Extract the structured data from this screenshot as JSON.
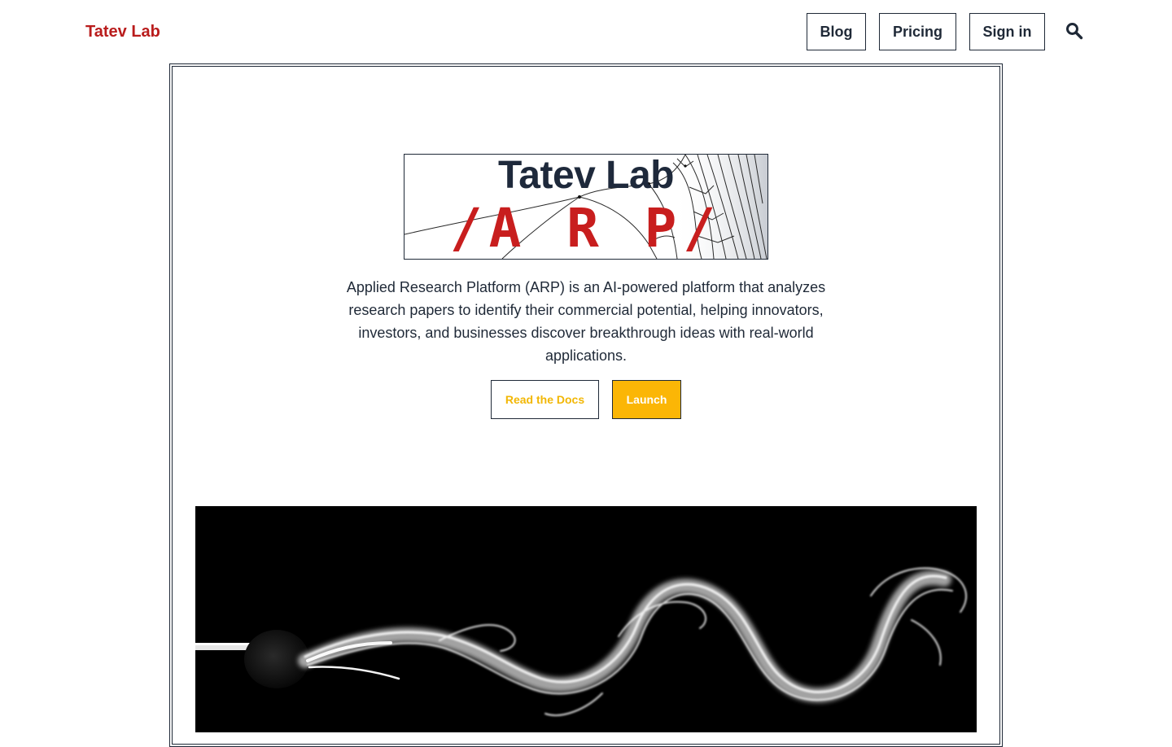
{
  "header": {
    "brand": "Tatev Lab",
    "nav": {
      "blog": "Blog",
      "pricing": "Pricing",
      "sign_in": "Sign in"
    },
    "search_icon": "search-icon"
  },
  "hero": {
    "logo": {
      "title": "Tatev Lab",
      "subtitle": "/A R P/"
    },
    "description": "Applied Research Platform (ARP) is an AI-powered platform that analyzes research papers to identify their commercial potential, helping innovators, investors, and businesses discover breakthrough ideas with real-world applications.",
    "buttons": {
      "docs": "Read the Docs",
      "launch": "Launch"
    }
  },
  "colors": {
    "brand": "#b91c1c",
    "logo_red": "#c81e1e",
    "accent": "#fbb606",
    "text": "#1f2937"
  }
}
